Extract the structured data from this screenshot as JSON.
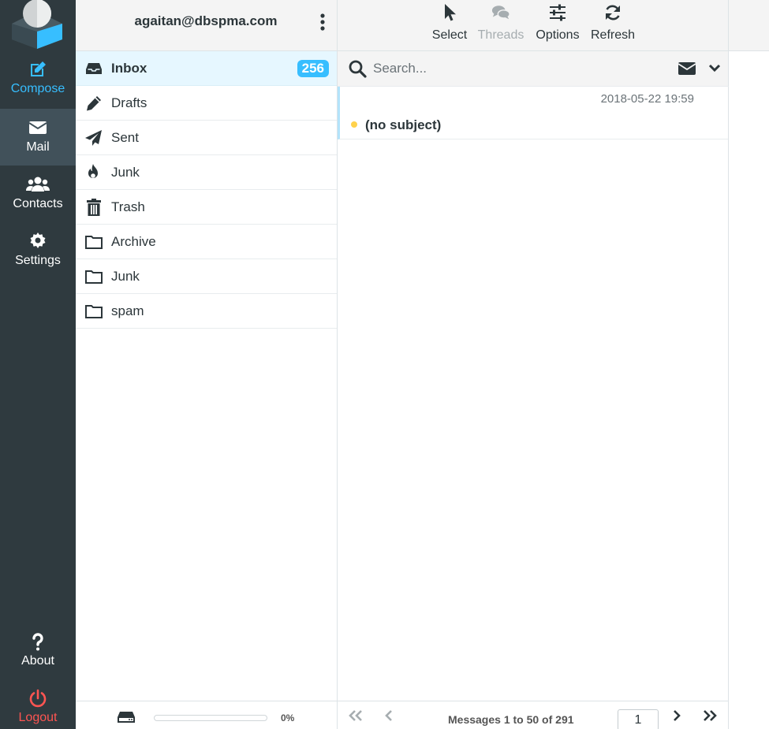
{
  "nav": {
    "compose": "Compose",
    "mail": "Mail",
    "contacts": "Contacts",
    "settings": "Settings",
    "about": "About",
    "logout": "Logout"
  },
  "account": "agaitan@dbspma.com",
  "folders": [
    {
      "name": "Inbox",
      "icon": "inbox-icon",
      "badge": "256"
    },
    {
      "name": "Drafts",
      "icon": "pencil-icon"
    },
    {
      "name": "Sent",
      "icon": "paper-plane-icon"
    },
    {
      "name": "Junk",
      "icon": "fire-icon"
    },
    {
      "name": "Trash",
      "icon": "trash-icon"
    },
    {
      "name": "Archive",
      "icon": "folder-icon"
    },
    {
      "name": "Junk",
      "icon": "folder-icon"
    },
    {
      "name": "spam",
      "icon": "folder-icon"
    }
  ],
  "quota": {
    "percent": 0,
    "text": "0%"
  },
  "toolbar": {
    "select": "Select",
    "threads": "Threads",
    "options": "Options",
    "refresh": "Refresh"
  },
  "search": {
    "placeholder": "Search..."
  },
  "messages": [
    {
      "date": "2018-05-22 19:59",
      "subject": "(no subject)",
      "unread": true
    }
  ],
  "pager": {
    "info": "Messages 1 to 50 of 291",
    "page": "1"
  },
  "colors": {
    "accent": "#37beff",
    "nav_bg": "#2f3a3f",
    "logout": "#ff5552",
    "unread_dot": "#ffd24c"
  }
}
